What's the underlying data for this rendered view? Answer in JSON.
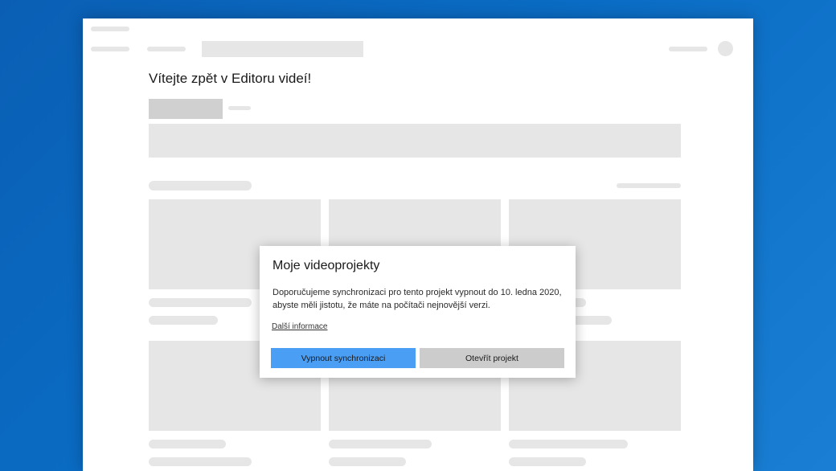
{
  "page": {
    "title": "Vítejte zpět v Editoru videí!"
  },
  "dialog": {
    "title": "Moje videoprojekty",
    "body": "Doporučujeme synchronizaci pro tento projekt vypnout do 10. ledna 2020, abyste měli jistotu, že máte na počítači nejnovější verzi.",
    "link": "Další informace",
    "primary_button": "Vypnout synchronizaci",
    "secondary_button": "Otevřít projekt"
  },
  "colors": {
    "background": "#0a6cc4",
    "primary_button": "#4a9ef4",
    "secondary_button": "#cccccc",
    "placeholder": "#e6e6e6"
  }
}
